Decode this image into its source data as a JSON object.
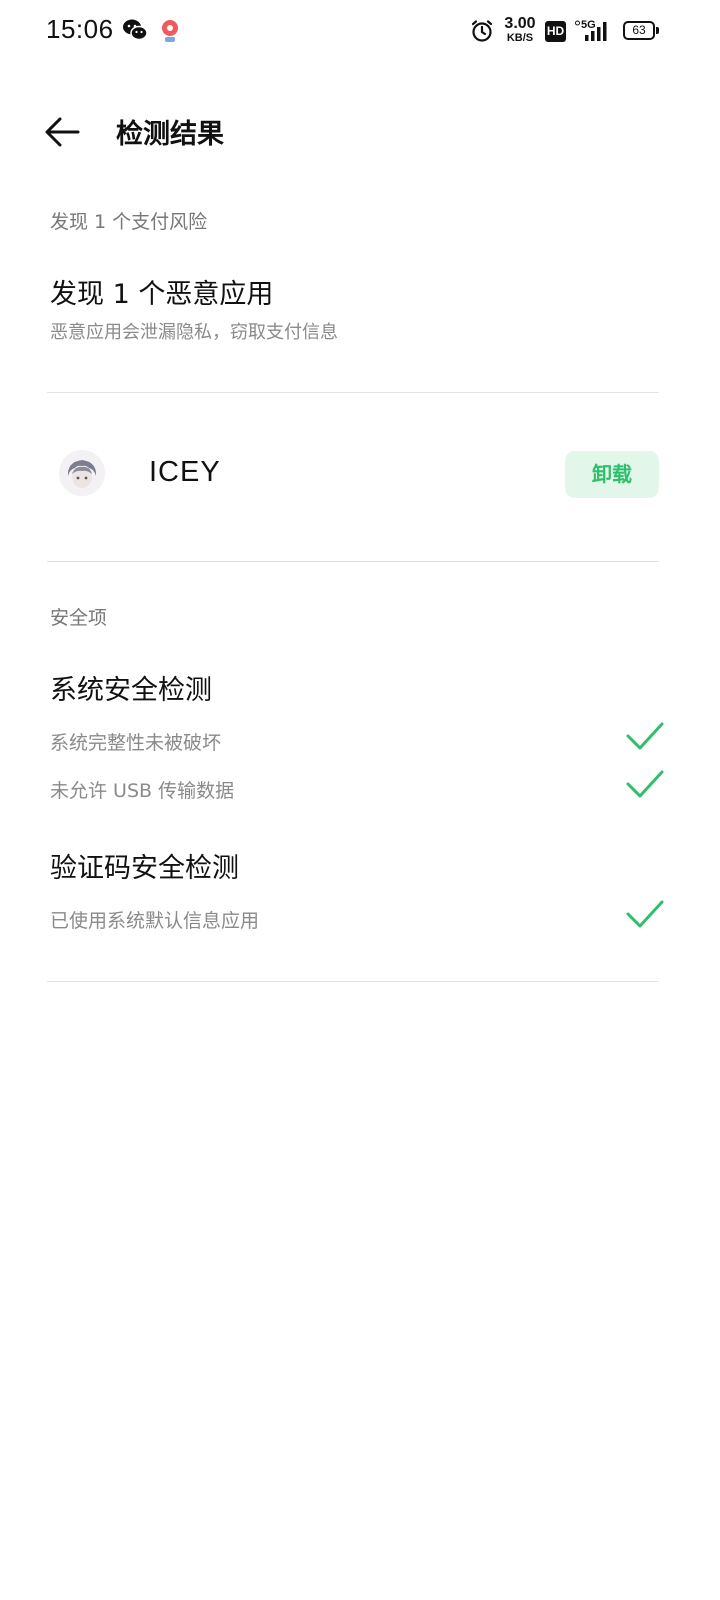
{
  "status_bar": {
    "time": "15:06",
    "net_speed_value": "3.00",
    "net_speed_unit": "KB/S",
    "hd_label": "HD",
    "net_type": "5G",
    "battery_level": "63"
  },
  "header": {
    "title": "检测结果"
  },
  "payment_risk": {
    "section_label": "发现 1 个支付风险",
    "title": "发现 1 个恶意应用",
    "subtitle": "恶意应用会泄漏隐私，窃取支付信息",
    "app": {
      "name": "ICEY",
      "action_label": "卸载"
    }
  },
  "safety": {
    "section_label": "安全项",
    "groups": [
      {
        "title": "系统安全检测",
        "items": [
          {
            "label": "系统完整性未被破坏",
            "status": "passed"
          },
          {
            "label": "未允许 USB 传输数据",
            "status": "passed"
          }
        ]
      },
      {
        "title": "验证码安全检测",
        "items": [
          {
            "label": "已使用系统默认信息应用",
            "status": "passed"
          }
        ]
      }
    ]
  },
  "colors": {
    "accent_green": "#2fbf6c",
    "button_bg": "#e2f7ea",
    "divider": "#e3e3e3"
  }
}
